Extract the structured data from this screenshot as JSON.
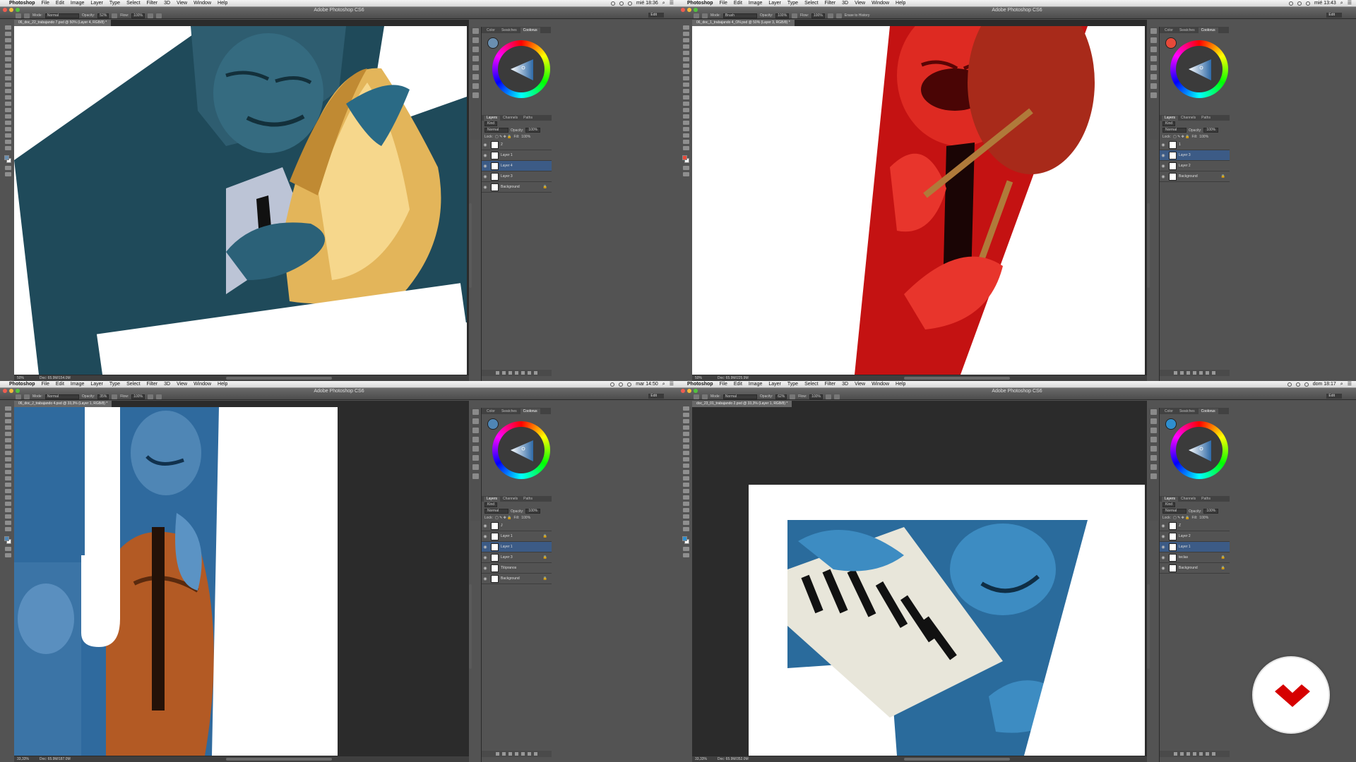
{
  "colors": {
    "menubar": "#e8e8e8",
    "chrome": "#535353",
    "selected_layer": "#3c5b86",
    "logo_red": "#d60000"
  },
  "windows": [
    {
      "id": "w1",
      "app_name": "Photoshop",
      "menus": [
        "File",
        "Edit",
        "Image",
        "Layer",
        "Type",
        "Select",
        "Filter",
        "3D",
        "View",
        "Window",
        "Help"
      ],
      "clock": "mié 18:36",
      "title": "Adobe Photoshop CS6",
      "doc_tab": "06_doc_22_trabajando 7.psd @ 50% (Layer 4, RGB/8) *",
      "options": {
        "mode_label": "Mode:",
        "mode": "Normal",
        "opacity_label": "Opacity:",
        "opacity": "52%",
        "flow_label": "Flow:",
        "flow": "100%",
        "extra": ""
      },
      "workspace": "Edit",
      "panel_tabs": [
        "Color",
        "Swatches",
        "Coolorus"
      ],
      "fg_color": "#6a8fb0",
      "layer_tabs": [
        "Layers",
        "Channels",
        "Paths"
      ],
      "layer_kind": "Kind",
      "blend": "Normal",
      "opacity_label": "Opacity:",
      "opacity": "100%",
      "lock_label": "Lock:",
      "fill_label": "Fill:",
      "fill": "100%",
      "layers": [
        {
          "name": "2",
          "selected": false,
          "locked": false
        },
        {
          "name": "Layer 1",
          "selected": false,
          "locked": false
        },
        {
          "name": "Layer 4",
          "selected": true,
          "locked": false
        },
        {
          "name": "Layer 3",
          "selected": false,
          "locked": false
        },
        {
          "name": "Background",
          "selected": false,
          "locked": true
        }
      ],
      "zoom": "50%",
      "doc_size": "Doc: 65.9M/154.0M"
    },
    {
      "id": "w2",
      "app_name": "Photoshop",
      "menus": [
        "File",
        "Edit",
        "Image",
        "Layer",
        "Type",
        "Select",
        "Filter",
        "3D",
        "View",
        "Window",
        "Help"
      ],
      "clock": "mié 13:43",
      "title": "Adobe Photoshop CS6",
      "doc_tab": "06_doc_1_trabajando 4_ON.psd @ 50% (Layer 3, RGB/8) *",
      "options": {
        "mode_label": "Mode:",
        "mode": "Brush",
        "opacity_label": "Opacity:",
        "opacity": "100%",
        "flow_label": "Flow:",
        "flow": "100%",
        "extra": "Erase to History"
      },
      "workspace": "Edit",
      "panel_tabs": [
        "Color",
        "Swatches",
        "Coolorus"
      ],
      "fg_color": "#e84a3a",
      "layer_tabs": [
        "Layers",
        "Channels",
        "Paths"
      ],
      "layer_kind": "Kind",
      "blend": "Normal",
      "opacity_label": "Opacity:",
      "opacity": "100%",
      "lock_label": "Lock:",
      "fill_label": "Fill:",
      "fill": "100%",
      "layers": [
        {
          "name": "1",
          "selected": false,
          "locked": false
        },
        {
          "name": "Layer 3",
          "selected": true,
          "locked": false
        },
        {
          "name": "Layer 2",
          "selected": false,
          "locked": false
        },
        {
          "name": "Background",
          "selected": false,
          "locked": true
        }
      ],
      "zoom": "50%",
      "doc_size": "Doc: 65.9M/225.9M"
    },
    {
      "id": "w3",
      "app_name": "Photoshop",
      "menus": [
        "File",
        "Edit",
        "Image",
        "Layer",
        "Type",
        "Select",
        "Filter",
        "3D",
        "View",
        "Window",
        "Help"
      ],
      "clock": "mar 14:50",
      "title": "Adobe Photoshop CS6",
      "doc_tab": "06_doc_J_trabajando 4.psd @ 33,3% (Layer 1, RGB/8) *",
      "options": {
        "mode_label": "Mode:",
        "mode": "Normal",
        "opacity_label": "Opacity:",
        "opacity": "35%",
        "flow_label": "Flow:",
        "flow": "100%",
        "extra": ""
      },
      "workspace": "Edit",
      "panel_tabs": [
        "Color",
        "Swatches",
        "Coolorus"
      ],
      "fg_color": "#4f86b5",
      "layer_tabs": [
        "Layers",
        "Channels",
        "Paths"
      ],
      "layer_kind": "Kind",
      "blend": "Normal",
      "opacity_label": "Opacity:",
      "opacity": "100%",
      "lock_label": "Lock:",
      "fill_label": "Fill:",
      "fill": "100%",
      "layers": [
        {
          "name": "J",
          "selected": false,
          "locked": false
        },
        {
          "name": "Layer 1",
          "selected": false,
          "locked": true
        },
        {
          "name": "Layer 1",
          "selected": true,
          "locked": false
        },
        {
          "name": "Layer 3",
          "selected": false,
          "locked": true
        },
        {
          "name": "Tlöpranos",
          "selected": false,
          "locked": false
        },
        {
          "name": "Background",
          "selected": false,
          "locked": true
        }
      ],
      "zoom": "33,33%",
      "doc_size": "Doc: 65.9M/187.0M"
    },
    {
      "id": "w4",
      "app_name": "Photoshop",
      "menus": [
        "File",
        "Edit",
        "Image",
        "Layer",
        "Type",
        "Select",
        "Filter",
        "3D",
        "View",
        "Window",
        "Help"
      ],
      "clock": "dom 18:17",
      "title": "Adobe Photoshop CS6",
      "doc_tab": "doc_23_01_trabajando 2.psd @ 33,3% (Layer 1, RGB/8) *",
      "options": {
        "mode_label": "Mode:",
        "mode": "Normal",
        "opacity_label": "Opacity:",
        "opacity": "62%",
        "flow_label": "Flow:",
        "flow": "100%",
        "extra": ""
      },
      "workspace": "Edit",
      "panel_tabs": [
        "Color",
        "Swatches",
        "Coolorus"
      ],
      "fg_color": "#2f8fcf",
      "layer_tabs": [
        "Layers",
        "Channels",
        "Paths"
      ],
      "layer_kind": "Kind",
      "blend": "Normal",
      "opacity_label": "Opacity:",
      "opacity": "100%",
      "lock_label": "Lock:",
      "fill_label": "Fill:",
      "fill": "100%",
      "layers": [
        {
          "name": "Z",
          "selected": false,
          "locked": false
        },
        {
          "name": "Layer 2",
          "selected": false,
          "locked": false
        },
        {
          "name": "Layer 1",
          "selected": true,
          "locked": false
        },
        {
          "name": "teclas",
          "selected": false,
          "locked": true
        },
        {
          "name": "Background",
          "selected": false,
          "locked": true
        }
      ],
      "zoom": "33,33%",
      "doc_size": "Doc: 65.9M/352.0M"
    }
  ]
}
